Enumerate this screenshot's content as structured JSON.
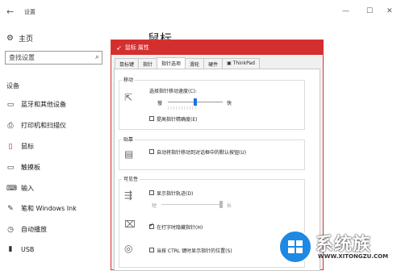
{
  "window": {
    "back_glyph": "←",
    "title": "设置",
    "minimize_glyph": "—",
    "maximize_glyph": "☐",
    "close_glyph": "✕"
  },
  "sidebar": {
    "home_label": "主页",
    "search_placeholder": "查找设置",
    "section_title": "设备",
    "items": [
      {
        "label": "蓝牙和其他设备",
        "icon": "bluetooth-devices-icon"
      },
      {
        "label": "打印机和扫描仪",
        "icon": "printer-icon"
      },
      {
        "label": "鼠标",
        "icon": "mouse-icon"
      },
      {
        "label": "触摸板",
        "icon": "touchpad-icon"
      },
      {
        "label": "输入",
        "icon": "keyboard-icon"
      },
      {
        "label": "笔和 Windows Ink",
        "icon": "pen-icon"
      },
      {
        "label": "自动播放",
        "icon": "autoplay-icon"
      },
      {
        "label": "USB",
        "icon": "usb-icon"
      }
    ],
    "active_item": "鼠标"
  },
  "main": {
    "heading": "鼠标"
  },
  "dialog": {
    "title": "鼠标 属性",
    "tabs": [
      "鼠标键",
      "指针",
      "指针选项",
      "滑轮",
      "硬件",
      "ThinkPad"
    ],
    "active_tab": "指针选项",
    "motion": {
      "group_label": "移动",
      "speed_label": "选择指针移动速度(C):",
      "slow_label": "慢",
      "fast_label": "快",
      "speed_level": 0.5,
      "precision_label": "提高指针精确度(E)",
      "precision_checked": false
    },
    "snap_to": {
      "group_label": "贴靠",
      "label": "自动将指针移动到对话框中的默认按钮(U)",
      "checked": false
    },
    "visibility": {
      "group_label": "可见性",
      "trails_label": "显示指针轨迹(D)",
      "trails_checked": false,
      "short_label": "短",
      "long_label": "长",
      "trail_level": 1.0,
      "hide_typing_label": "在打字时隐藏指针(H)",
      "hide_typing_checked": true,
      "show_ctrl_label": "当按 CTRL 键时显示指针的位置(S)",
      "show_ctrl_checked": false
    }
  },
  "watermark": {
    "text": "系统族",
    "url": "WWW.XITONGZU.COM"
  },
  "colors": {
    "accent_red": "#d32f2f",
    "slider_blue": "#1e6fd9",
    "watermark_blue": "#1e88e5"
  }
}
